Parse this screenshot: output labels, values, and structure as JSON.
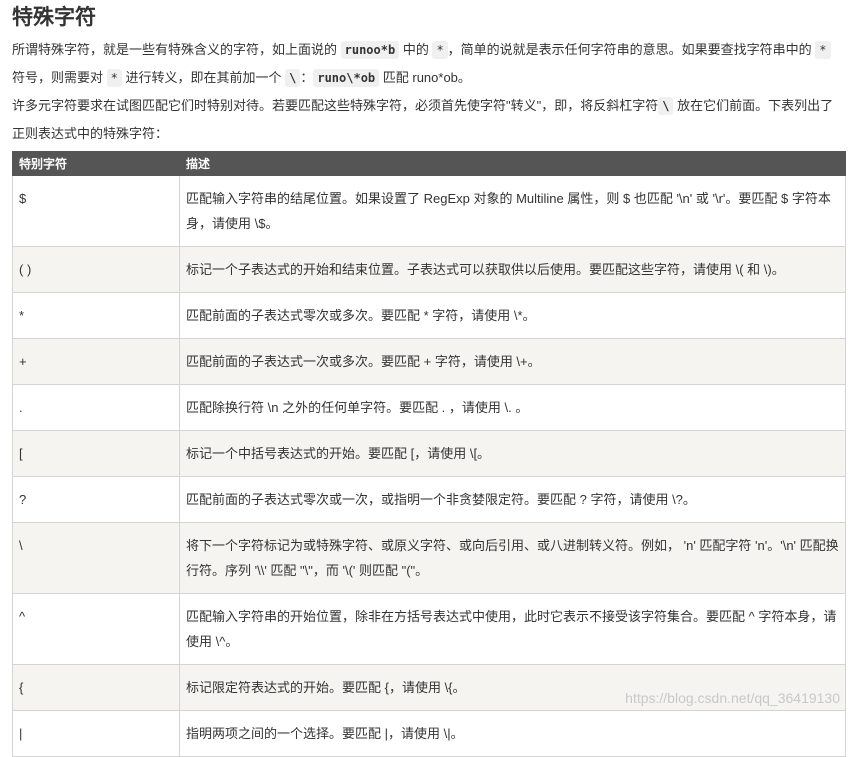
{
  "heading": "特殊字符",
  "intro": {
    "p1": {
      "t1": "所谓特殊字符，就是一些有特殊含义的字符，如上面说的 ",
      "c1": "runoo*b",
      "t2": " 中的 ",
      "c2": "*",
      "t3": "，简单的说就是表示任何字符串的意思。如果要查找字符串中的 ",
      "c3": "*",
      "t4": " 符号，则需要对 ",
      "c4": "*",
      "t5": " 进行转义，即在其前加一个 ",
      "c5": "\\",
      "t6": "：",
      "c6": "runo\\*ob",
      "t7": " 匹配 runo*ob。"
    },
    "p2": {
      "t1": "许多元字符要求在试图匹配它们时特别对待。若要匹配这些特殊字符，必须首先使字符\"转义\"，即，将反斜杠字符",
      "c1": "\\",
      "t2": " 放在它们前面。下表列出了正则表达式中的特殊字符："
    }
  },
  "table": {
    "headers": [
      "特别字符",
      "描述"
    ],
    "rows": [
      {
        "char": "$",
        "desc": "匹配输入字符串的结尾位置。如果设置了 RegExp 对象的 Multiline 属性，则 $ 也匹配 '\\n' 或 '\\r'。要匹配 $ 字符本身，请使用 \\$。"
      },
      {
        "char": "( )",
        "desc": "标记一个子表达式的开始和结束位置。子表达式可以获取供以后使用。要匹配这些字符，请使用 \\( 和 \\)。"
      },
      {
        "char": "*",
        "desc": "匹配前面的子表达式零次或多次。要匹配 * 字符，请使用 \\*。"
      },
      {
        "char": "+",
        "desc": "匹配前面的子表达式一次或多次。要匹配 + 字符，请使用 \\+。"
      },
      {
        "char": ".",
        "desc": "匹配除换行符 \\n 之外的任何单字符。要匹配 . ，请使用 \\. 。"
      },
      {
        "char": "[",
        "desc": "标记一个中括号表达式的开始。要匹配 [，请使用 \\[。"
      },
      {
        "char": "?",
        "desc": "匹配前面的子表达式零次或一次，或指明一个非贪婪限定符。要匹配 ? 字符，请使用 \\?。"
      },
      {
        "char": "\\",
        "desc": "将下一个字符标记为或特殊字符、或原义字符、或向后引用、或八进制转义符。例如， 'n' 匹配字符 'n'。'\\n' 匹配换行符。序列 '\\\\' 匹配 \"\\\"，而 '\\(' 则匹配 \"(\"。"
      },
      {
        "char": "^",
        "desc": "匹配输入字符串的开始位置，除非在方括号表达式中使用，此时它表示不接受该字符集合。要匹配 ^ 字符本身，请使用 \\^。"
      },
      {
        "char": "{",
        "desc": "标记限定符表达式的开始。要匹配 {，请使用 \\{。"
      },
      {
        "char": "|",
        "desc": "指明两项之间的一个选择。要匹配 |，请使用 \\|。"
      }
    ]
  },
  "watermark": "https://blog.csdn.net/qq_36419130"
}
